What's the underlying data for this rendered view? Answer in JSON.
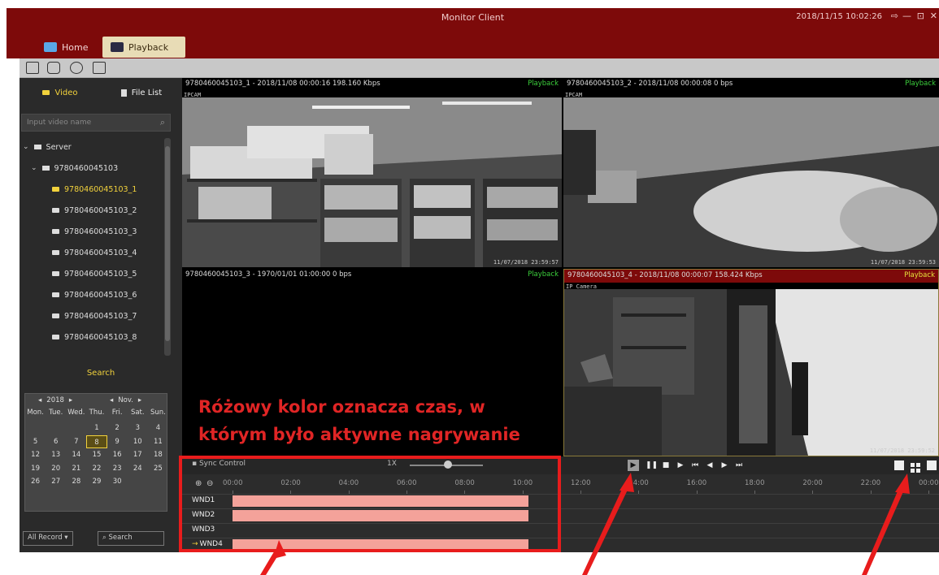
{
  "window": {
    "title": "Monitor Client",
    "datetime": "2018/11/15 10:02:26",
    "controls": [
      "⇨",
      "—",
      "⊡",
      "✕"
    ]
  },
  "tabs": {
    "home": "Home",
    "playback": "Playback"
  },
  "sidebar": {
    "tab_video": "Video",
    "tab_file_list": "File List",
    "search_placeholder": "Input video name",
    "server_label": "Server",
    "device_label": "9780460045103",
    "channels": [
      "9780460045103_1",
      "9780460045103_2",
      "9780460045103_3",
      "9780460045103_4",
      "9780460045103_5",
      "9780460045103_6",
      "9780460045103_7",
      "9780460045103_8"
    ],
    "active_channel_index": 0,
    "search_button": "Search"
  },
  "calendar": {
    "year": "2018",
    "month": "Nov.",
    "weekdays": [
      "Mon.",
      "Tue.",
      "Wed.",
      "Thu.",
      "Fri.",
      "Sat.",
      "Sun."
    ],
    "days": [
      "",
      "",
      "",
      "1",
      "2",
      "3",
      "4",
      "5",
      "6",
      "7",
      "8",
      "9",
      "10",
      "11",
      "12",
      "13",
      "14",
      "15",
      "16",
      "17",
      "18",
      "19",
      "20",
      "21",
      "22",
      "23",
      "24",
      "25",
      "26",
      "27",
      "28",
      "29",
      "30",
      "",
      ""
    ],
    "selected_day": "8",
    "record_filter": "All Record",
    "search_label": "Search"
  },
  "panes": [
    {
      "header": "9780460045103_1 - 2018/11/08 00:00:16 198.160 Kbps",
      "status": "Playback",
      "osd_name": "IPCAM",
      "osd_time": "11/07/2018 23:59:57",
      "active": false
    },
    {
      "header": "9780460045103_2 - 2018/11/08 00:00:08 0 bps",
      "status": "Playback",
      "osd_name": "IPCAM",
      "osd_time": "11/07/2018 23:59:53",
      "active": false
    },
    {
      "header": "9780460045103_3 - 1970/01/01 01:00:00 0 bps",
      "status": "Playback",
      "osd_name": "",
      "osd_time": "",
      "active": false
    },
    {
      "header": "9780460045103_4 - 2018/11/08 00:00:07 158.424 Kbps",
      "status": "Playback",
      "osd_name": "IP Camera",
      "osd_time": "11/07/2018 23:59:52",
      "active": true
    }
  ],
  "annotation": {
    "line1": "Różowy kolor oznacza czas, w",
    "line2": "którym było aktywne nagrywanie"
  },
  "timeline": {
    "sync_label": "Sync Control",
    "speed": "1X",
    "ticks": [
      "00:00",
      "02:00",
      "04:00",
      "06:00",
      "08:00",
      "10:00",
      "12:00",
      "14:00",
      "16:00",
      "18:00",
      "20:00",
      "22:00",
      "00:00"
    ],
    "rows": [
      {
        "label": "WND1",
        "record_start_hour": 0,
        "record_end_hour": 10.2,
        "current": false
      },
      {
        "label": "WND2",
        "record_start_hour": 0,
        "record_end_hour": 10.2,
        "current": false
      },
      {
        "label": "WND3",
        "record_start_hour": null,
        "record_end_hour": null,
        "current": false
      },
      {
        "label": "WND4",
        "record_start_hour": 0,
        "record_end_hour": 10.2,
        "current": true
      }
    ]
  },
  "colors": {
    "brand": "#7d0a0a",
    "recording": "#f4a29a",
    "highlight": "#f2d23c",
    "annotation": "#e02525"
  }
}
